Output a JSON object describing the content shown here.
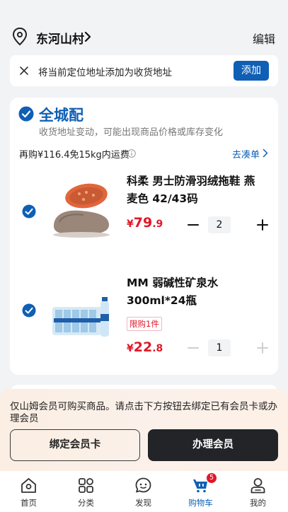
{
  "header": {
    "location": "东河山村",
    "edit_label": "编辑"
  },
  "notice": {
    "message": "将当前定位地址添加为收货地址",
    "add_label": "添加"
  },
  "store": {
    "title": "全城配",
    "subtitle": "收货地址变动，可能出现商品价格或库存变化",
    "shipping_text": "再购¥116.4免15kg内运费",
    "go_add_label": "去凑单",
    "items": [
      {
        "name": "科柔 男士防滑羽绒拖鞋 燕麦色 42/43码",
        "price_symbol": "¥",
        "price_int": "79",
        "price_dec": ".9",
        "quantity": "2",
        "checked": true
      },
      {
        "name": "MM 弱碱性矿泉水 300ml*24瓶",
        "tag": "限购1件",
        "price_symbol": "¥",
        "price_int": "22",
        "price_dec": ".8",
        "quantity": "1",
        "checked": true
      }
    ]
  },
  "member": {
    "message": "仅山姆会员可购买商品。请点击下方按钮去绑定已有会员卡或办理会员",
    "bind_label": "绑定会员卡",
    "join_label": "办理会员"
  },
  "tabbar": {
    "items": [
      {
        "label": "首页",
        "icon": "home-icon"
      },
      {
        "label": "分类",
        "icon": "category-icon"
      },
      {
        "label": "发现",
        "icon": "discover-icon"
      },
      {
        "label": "购物车",
        "icon": "cart-icon",
        "badge": "5",
        "active": true
      },
      {
        "label": "我的",
        "icon": "profile-icon"
      }
    ]
  },
  "colors": {
    "accent": "#0f5fb5",
    "price": "#e0182a",
    "dark_button": "#222428"
  }
}
